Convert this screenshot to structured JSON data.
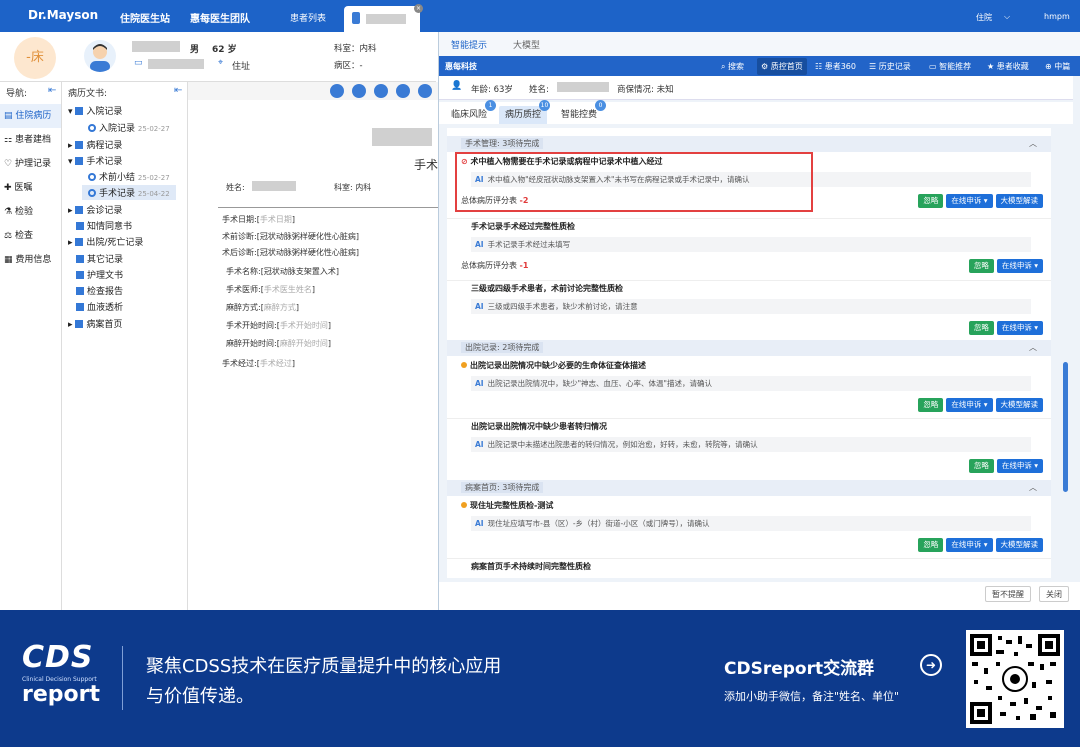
{
  "topbar": {
    "logo": "Dr.Mayson",
    "nav1": "住院医生站",
    "nav2": "惠每医生团队",
    "tab_patients": "患者列表",
    "right_user": "住院",
    "right_name": "hmpm"
  },
  "patient": {
    "bed": "-床",
    "sex": "男",
    "age": "62 岁",
    "address_label": "住址",
    "dept": "科室：内科",
    "ward": "病区：-"
  },
  "leftnav": {
    "title": "导航:",
    "items": [
      "住院病历",
      "患者建档",
      "护理记录",
      "医嘱",
      "检验",
      "检查",
      "费用信息"
    ]
  },
  "tree": {
    "title": "病历文书:",
    "items": [
      {
        "label": "入院记录",
        "date": ""
      },
      {
        "label": "入院记录",
        "date": "25-02-27"
      },
      {
        "label": "病程记录",
        "date": ""
      },
      {
        "label": "手术记录",
        "date": ""
      },
      {
        "label": "术前小结",
        "date": "25-02-27"
      },
      {
        "label": "手术记录",
        "date": "25-04-22"
      },
      {
        "label": "会诊记录",
        "date": ""
      },
      {
        "label": "知情同意书",
        "date": ""
      },
      {
        "label": "出院/死亡记录",
        "date": ""
      },
      {
        "label": "其它记录",
        "date": ""
      },
      {
        "label": "护理文书",
        "date": ""
      },
      {
        "label": "检查报告",
        "date": ""
      },
      {
        "label": "血液透析",
        "date": ""
      },
      {
        "label": "病案首页",
        "date": ""
      }
    ]
  },
  "doc": {
    "title": "手术",
    "name_label": "姓名:",
    "dept_label": "科室:",
    "dept_value": "内科",
    "lines": [
      {
        "label": "手术日期:",
        "value": "手术日期"
      },
      {
        "label": "术前诊断:",
        "value": "冠状动脉粥样硬化性心脏病"
      },
      {
        "label": "术后诊断:",
        "value": "冠状动脉粥样硬化性心脏病"
      },
      {
        "label": "手术名称:",
        "value": "冠状动脉支架置入术"
      },
      {
        "label": "手术医师:",
        "value": "手术医生姓名"
      },
      {
        "label": "麻醉方式:",
        "value": "麻醉方式"
      },
      {
        "label": "手术开始时间:",
        "value": "手术开始时间"
      },
      {
        "label": "麻醉开始时间:",
        "value": "麻醉开始时间"
      },
      {
        "label": "手术经过:",
        "value": "手术经过"
      }
    ]
  },
  "right": {
    "tab1": "智能提示",
    "tab2": "大模型",
    "brand": "惠每科技",
    "toolbar": [
      "搜索",
      "质控首页",
      "患者360",
      "历史记录",
      "智能推荐",
      "患者收藏",
      "中篇"
    ],
    "age": "年龄:   63岁",
    "name_label": "姓名:",
    "insurance": "商保情况:   未知",
    "subtabs": [
      {
        "label": "临床风险",
        "badge": "1"
      },
      {
        "label": "病历质控",
        "badge": "10"
      },
      {
        "label": "智能控费",
        "badge": "0"
      }
    ],
    "sections": [
      {
        "title": "手术管理: 3项待完成"
      },
      {
        "title": "出院记录: 2项待完成"
      },
      {
        "title": "病案首页: 3项待完成"
      }
    ],
    "items": [
      {
        "title": "术中植入物需要在手术记录或病程中记录术中植入经过",
        "ai": "术中植入物\"经皮冠状动脉支架置入术\"未书写在病程记录或手术记录中，请确认",
        "score": "总体病历评分表",
        "score_val": "-2"
      },
      {
        "title": "手术记录手术经过完整性质检",
        "ai": "手术记录手术经过未填写",
        "score": "总体病历评分表",
        "score_val": "-1"
      },
      {
        "title": "三级或四级手术患者，术前讨论完整性质检",
        "ai": "三级或四级手术患者，缺少术前讨论，请注意"
      },
      {
        "title": "出院记录出院情况中缺少必要的生命体征查体描述",
        "ai": "出院记录出院情况中，缺少\"神志、血压、心率、体温\"描述，请确认"
      },
      {
        "title": "出院记录出院情况中缺少患者转归情况",
        "ai": "出院记录中未描述出院患者的转归情况，例如治愈，好转，未愈，转院等，请确认"
      },
      {
        "title": "现住址完整性质检-测试",
        "ai": "现住址应填写市-县（区）-乡（村）街道-小区（或门牌号），请确认"
      },
      {
        "title": "病案首页手术持续时间完整性质检",
        "ai": ""
      }
    ],
    "btn_ignore": "忽略",
    "btn_appeal": "在线申诉",
    "btn_llm": "大模型解读",
    "btn_nosnooze": "暂不提醒",
    "btn_close": "关闭"
  },
  "footer": {
    "logo_cds": "CDS",
    "logo_sub": "Clinical Decision Support",
    "logo_report": "report",
    "headline1": "聚焦CDSS技术在医疗质量提升中的核心应用",
    "headline2": "与价值传递。",
    "group": "CDSreport交流群",
    "note": "添加小助手微信，备注\"姓名、单位\""
  }
}
